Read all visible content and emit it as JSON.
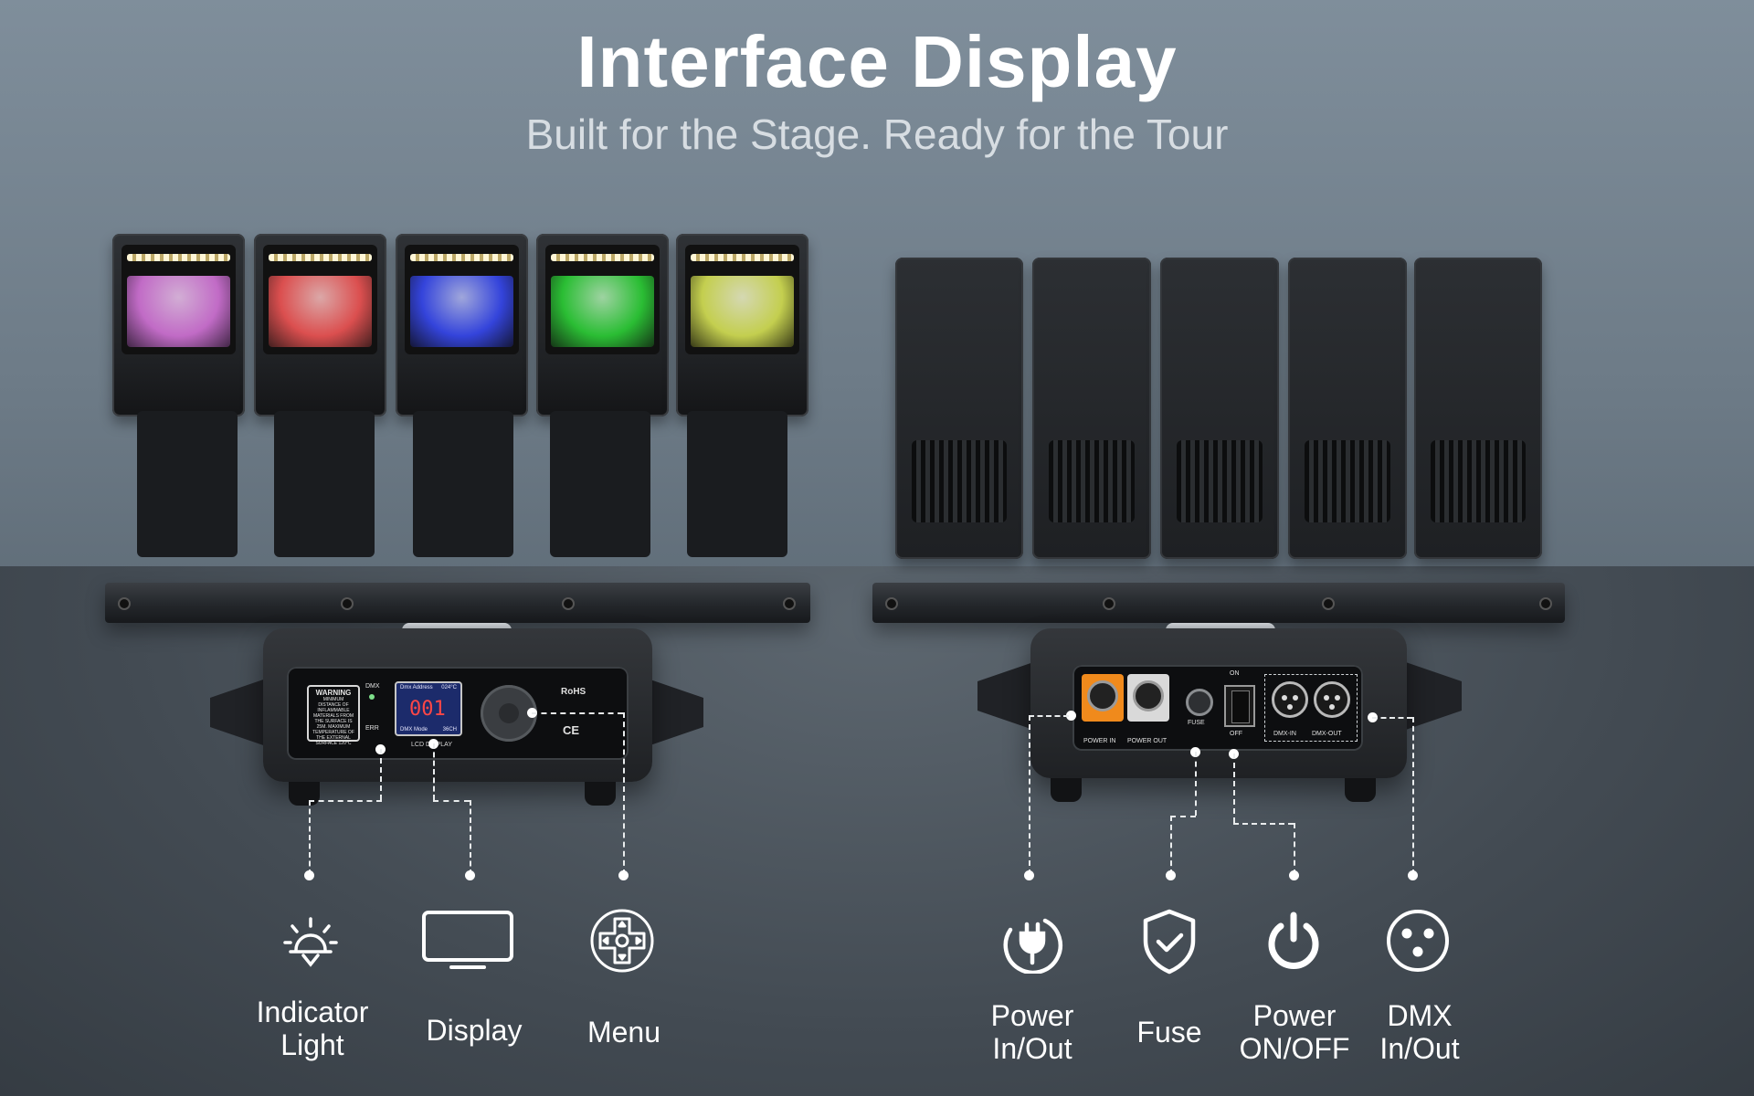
{
  "header": {
    "title": "Interface Display",
    "subtitle": "Built for the Stage. Ready for the Tour"
  },
  "front_panel": {
    "warning_title": "WARNING",
    "warning_text": "MINIMUM DISTANCE OF INFLAMMABLE MATERIALS FROM THE SURFACE IS 25M. MAXIMUM TEMPERATURE OF THE EXTERNAL SURFACE 120°C",
    "led_dmx": "DMX",
    "led_err": "ERR",
    "lcd_top_left": "Dmx Address",
    "lcd_top_right": "024°C",
    "lcd_value": "001",
    "lcd_bottom_left": "DMX Mode",
    "lcd_bottom_right": "36CH",
    "lcd_caption": "LCD DISPLAY",
    "rohs": "RoHS",
    "ce": "CE"
  },
  "rear_panel": {
    "power_in": "POWER IN",
    "power_out": "POWER OUT",
    "fuse": "FUSE",
    "switch_on": "ON",
    "switch_off": "OFF",
    "dmx_in": "DMX-IN",
    "dmx_out": "DMX-OUT"
  },
  "features_front": [
    {
      "icon": "bulb-icon",
      "label_line1": "Indicator",
      "label_line2": "Light"
    },
    {
      "icon": "monitor-icon",
      "label_line1": "Display",
      "label_line2": ""
    },
    {
      "icon": "dpad-icon",
      "label_line1": "Menu",
      "label_line2": ""
    }
  ],
  "features_rear": [
    {
      "icon": "plug-icon",
      "label_line1": "Power",
      "label_line2": "In/Out"
    },
    {
      "icon": "shield-check-icon",
      "label_line1": "Fuse",
      "label_line2": ""
    },
    {
      "icon": "power-icon",
      "label_line1": "Power",
      "label_line2": "ON/OFF"
    },
    {
      "icon": "dmx-connector-icon",
      "label_line1": "DMX",
      "label_line2": "In/Out"
    }
  ],
  "colors": {
    "head_glows": [
      "#e07be6",
      "#ff5a5a",
      "#3a4dff",
      "#2fdc3a",
      "#e3f05a"
    ],
    "power_in_accent": "#f08a1c",
    "power_out_accent": "#d9d9d9",
    "lcd_background": "#1c2b6b",
    "lcd_digits": "#ff4646"
  }
}
